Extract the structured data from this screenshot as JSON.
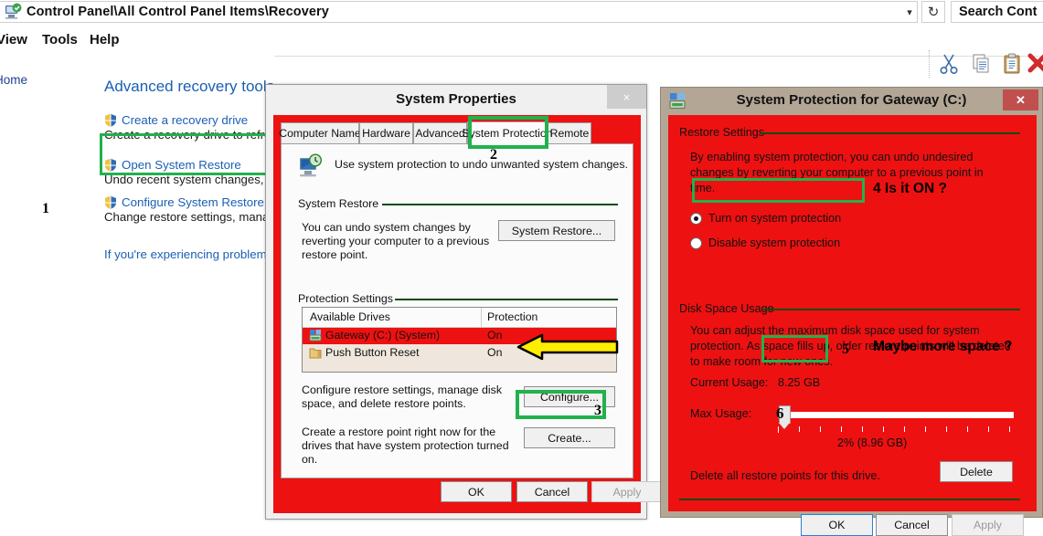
{
  "explorer": {
    "address": "Control Panel\\All Control Panel Items\\Recovery",
    "address_icon": "recovery-icon",
    "dropdown_icon": "chevron-down-icon",
    "refresh_icon": "refresh-icon",
    "search_placeholder": "Search Cont",
    "menu": [
      {
        "label": "View"
      },
      {
        "label": "Tools"
      },
      {
        "label": "Help"
      }
    ],
    "toolbar_icons": [
      {
        "name": "cut-icon"
      },
      {
        "name": "copy-icon"
      },
      {
        "name": "paste-icon"
      },
      {
        "name": "delete-icon"
      }
    ]
  },
  "leftpane": {
    "home_link": "Home",
    "title": "Advanced recovery tools",
    "tools": [
      {
        "link": "Create a recovery drive",
        "desc": "Create a recovery drive to refresh"
      },
      {
        "link": "Open System Restore",
        "desc": "Undo recent system changes, bu"
      },
      {
        "link": "Configure System Restore",
        "desc": "Change restore settings, manage"
      }
    ],
    "footer_link": "If you're experiencing problems",
    "callout_1": "1"
  },
  "system_properties": {
    "title": "System Properties",
    "close_label": "×",
    "tabs": [
      {
        "label": "Computer Name",
        "active": false
      },
      {
        "label": "Hardware",
        "active": false
      },
      {
        "label": "Advanced",
        "active": false
      },
      {
        "label": "System Protection",
        "active": true
      },
      {
        "label": "Remote",
        "active": false
      }
    ],
    "intro_text": "Use system protection to undo unwanted system changes.",
    "intro_icon": "computer-clock-icon",
    "system_restore": {
      "group_label": "System Restore",
      "desc": "You can undo system changes by reverting your computer to a previous restore point.",
      "button": "System Restore..."
    },
    "protection_settings": {
      "group_label": "Protection Settings",
      "columns": [
        "Available Drives",
        "Protection"
      ],
      "rows": [
        {
          "icon": "system-drive-icon",
          "name": "Gateway (C:) (System)",
          "protection": "On",
          "selected": true
        },
        {
          "icon": "folder-drive-icon",
          "name": "Push Button Reset",
          "protection": "On",
          "selected": false
        }
      ],
      "configure_desc": "Configure restore settings, manage disk space, and delete restore points.",
      "configure_button": "Configure...",
      "create_desc": "Create a restore point right now for the drives that have system protection turned on.",
      "create_button": "Create..."
    },
    "footer": {
      "ok": "OK",
      "cancel": "Cancel",
      "apply": "Apply",
      "apply_disabled": true
    },
    "callout_2": "2",
    "callout_3": "3"
  },
  "system_protection": {
    "title": "System Protection for Gateway (C:)",
    "title_icon": "system-drive-icon",
    "close_label": "✕",
    "restore_settings": {
      "group_label": "Restore Settings",
      "desc": "By enabling system protection, you can undo undesired changes by reverting your computer to a previous point in time.",
      "options": [
        {
          "label": "Turn on system protection",
          "checked": true
        },
        {
          "label": "Disable system protection",
          "checked": false
        }
      ]
    },
    "disk_space": {
      "group_label": "Disk Space Usage",
      "desc": "You can adjust the maximum disk space used for system protection. As space fills up, older restore points will be deleted to make room for new ones.",
      "current_usage_label": "Current Usage:",
      "current_usage_value": "8.25 GB",
      "max_usage_label": "Max Usage:",
      "max_usage_value": "2% (8.96 GB)",
      "slider_percent": 2
    },
    "delete": {
      "desc": "Delete all restore points for this drive.",
      "button": "Delete"
    },
    "footer": {
      "ok": "OK",
      "cancel": "Cancel",
      "apply": "Apply",
      "apply_disabled": true
    },
    "callout_4": "4  Is it ON ?",
    "callout_5_num": "5",
    "callout_5": "Maybe more space ?",
    "callout_6": "6"
  },
  "annotations": {
    "highlight_color": "#22b14c",
    "overlay_color": "#ee1111",
    "arrow_color": "#ffee00"
  }
}
